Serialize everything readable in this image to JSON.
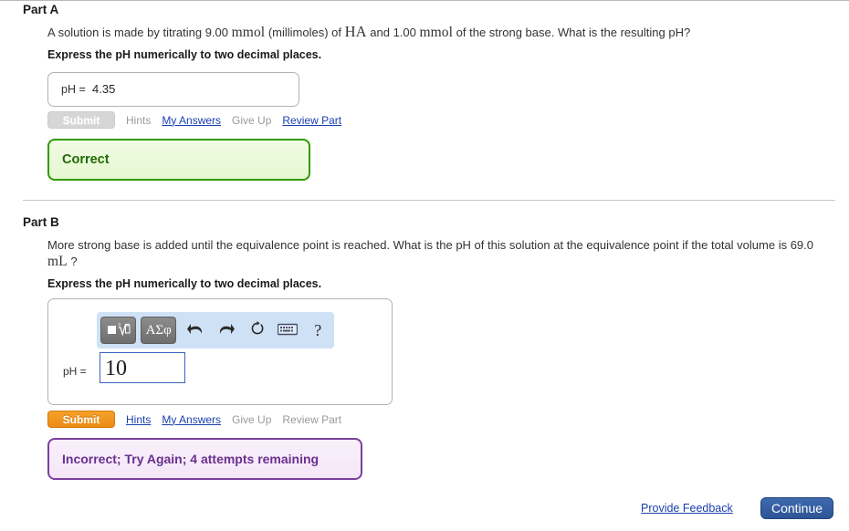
{
  "parts": [
    {
      "heading": "Part A",
      "question_segments": [
        {
          "text": "A solution is made by titrating 9.00 ",
          "style": "plain"
        },
        {
          "text": "mmol",
          "style": "math"
        },
        {
          "text": " (millimoles) of ",
          "style": "plain"
        },
        {
          "text": "HA",
          "style": "math-big"
        },
        {
          "text": " and 1.00 ",
          "style": "plain"
        },
        {
          "text": "mmol",
          "style": "math"
        },
        {
          "text": " of the strong base. What is the resulting pH?",
          "style": "plain"
        }
      ],
      "instruction": "Express the pH numerically to two decimal places.",
      "answer_label": "pH =",
      "answer_value": "4.35",
      "submit_label": "Submit",
      "submit_enabled": false,
      "links": [
        {
          "label": "Hints",
          "enabled": false
        },
        {
          "label": "My Answers",
          "enabled": true
        },
        {
          "label": "Give Up",
          "enabled": false
        },
        {
          "label": "Review Part",
          "enabled": true
        }
      ],
      "feedback": {
        "text": "Correct",
        "kind": "correct"
      }
    },
    {
      "heading": "Part B",
      "question_segments": [
        {
          "text": "More strong base is added until the equivalence point is reached. What is the pH of this solution at the equivalence point if the total volume is 69.0 ",
          "style": "plain"
        },
        {
          "text": "mL",
          "style": "math"
        },
        {
          "text": " ?",
          "style": "plain"
        }
      ],
      "instruction": "Express the pH numerically to two decimal places.",
      "answer_label": "pH =",
      "answer_value": "10",
      "submit_label": "Submit",
      "submit_enabled": true,
      "links": [
        {
          "label": "Hints",
          "enabled": true
        },
        {
          "label": "My Answers",
          "enabled": true
        },
        {
          "label": "Give Up",
          "enabled": false
        },
        {
          "label": "Review Part",
          "enabled": false
        }
      ],
      "feedback": {
        "text": "Incorrect; Try Again; 4 attempts remaining",
        "kind": "incorrect"
      }
    }
  ],
  "math_toolbar": {
    "buttons": [
      {
        "name": "template-palette-button",
        "icon": "square-nth-root-icon",
        "label": ""
      },
      {
        "name": "greek-symbols-button",
        "icon": "greek-letters-icon",
        "label": "ΑΣφ"
      },
      {
        "name": "undo-button",
        "icon": "undo-arrow-icon",
        "label": ""
      },
      {
        "name": "redo-button",
        "icon": "redo-arrow-icon",
        "label": ""
      },
      {
        "name": "reset-button",
        "icon": "refresh-circular-arrow-icon",
        "label": ""
      },
      {
        "name": "keyboard-button",
        "icon": "keyboard-icon",
        "label": ""
      },
      {
        "name": "help-button",
        "icon": "question-mark-icon",
        "label": "?"
      }
    ]
  },
  "footer": {
    "provide_feedback_label": "Provide Feedback",
    "continue_label": "Continue"
  },
  "colors": {
    "link_blue": "#1a3fb0",
    "submit_orange": "#ec8c16",
    "correct_green": "#339900",
    "incorrect_purple": "#7b3f9d",
    "continue_blue": "#2e5596",
    "toolbar_blue": "#cfe1f5"
  }
}
